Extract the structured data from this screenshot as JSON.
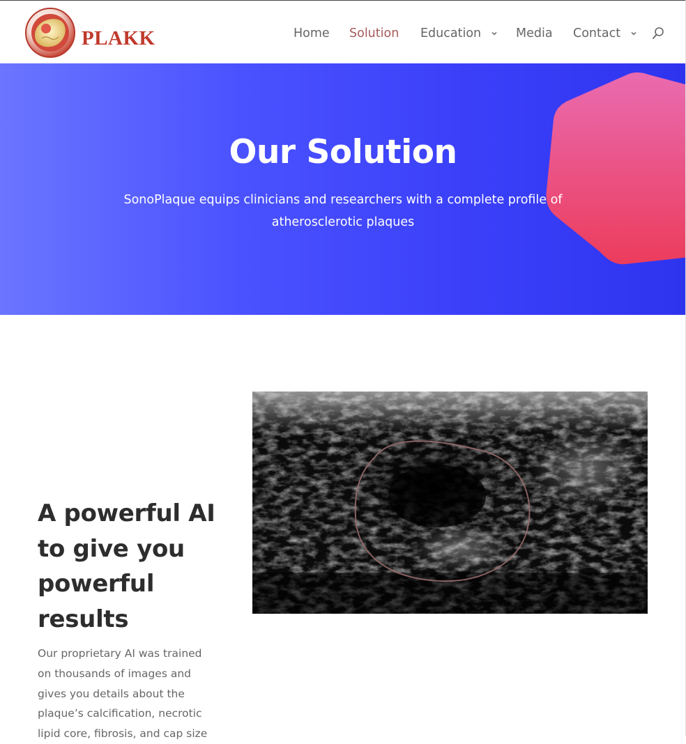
{
  "brand": {
    "name": "PLAKK",
    "accent": "#c0392b"
  },
  "nav": {
    "items": [
      {
        "label": "Home",
        "active": false,
        "dropdown": false
      },
      {
        "label": "Solution",
        "active": true,
        "dropdown": false
      },
      {
        "label": "Education",
        "active": false,
        "dropdown": true
      },
      {
        "label": "Media",
        "active": false,
        "dropdown": false
      },
      {
        "label": "Contact",
        "active": false,
        "dropdown": true
      }
    ],
    "search_icon": "search-icon",
    "dropdown_icon": "chevron-down-icon",
    "active_color": "#a55b5b"
  },
  "hero": {
    "title": "Our Solution",
    "subtitle_line1": "SonoPlaque equips clinicians and researchers with a complete profile of",
    "subtitle_line2": "atherosclerotic plaques",
    "gradient_start": "#6b75ff",
    "gradient_end": "#2e34ee",
    "shape_color": "#e8456e"
  },
  "section": {
    "title_lines": [
      "A powerful AI",
      "to give you",
      "powerful",
      "results"
    ],
    "body_lines": [
      "Our proprietary AI was trained",
      "on thousands of images and",
      "gives you details about the",
      "plaque’s calcification, necrotic",
      "lipid core, fibrosis, and cap size"
    ]
  }
}
